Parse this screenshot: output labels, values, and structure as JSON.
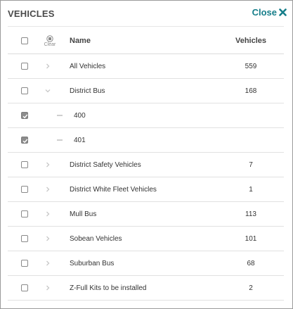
{
  "header": {
    "title": "VEHICLES",
    "close_label": "Close"
  },
  "columns": {
    "clear_label": "Clear",
    "name": "Name",
    "count": "Vehicles"
  },
  "rows": [
    {
      "name": "All Vehicles",
      "count": "559",
      "checked": false,
      "expander": "chevron-right"
    },
    {
      "name": "District Bus",
      "count": "168",
      "checked": false,
      "expander": "chevron-down"
    },
    {
      "name": "400",
      "count": "",
      "checked": true,
      "expander": "dash"
    },
    {
      "name": "401",
      "count": "",
      "checked": true,
      "expander": "dash"
    },
    {
      "name": "District Safety Vehicles",
      "count": "7",
      "checked": false,
      "expander": "chevron-right"
    },
    {
      "name": "District White Fleet Vehicles",
      "count": "1",
      "checked": false,
      "expander": "chevron-right"
    },
    {
      "name": "Mull Bus",
      "count": "113",
      "checked": false,
      "expander": "chevron-right"
    },
    {
      "name": "Sobean Vehicles",
      "count": "101",
      "checked": false,
      "expander": "chevron-right"
    },
    {
      "name": "Suburban Bus",
      "count": "68",
      "checked": false,
      "expander": "chevron-right"
    },
    {
      "name": "Z-Full Kits to be installed",
      "count": "2",
      "checked": false,
      "expander": "chevron-right"
    }
  ],
  "colors": {
    "accent": "#167e8a",
    "checked_fill": "#8c8c8c",
    "row_border": "#e1e1e1"
  }
}
